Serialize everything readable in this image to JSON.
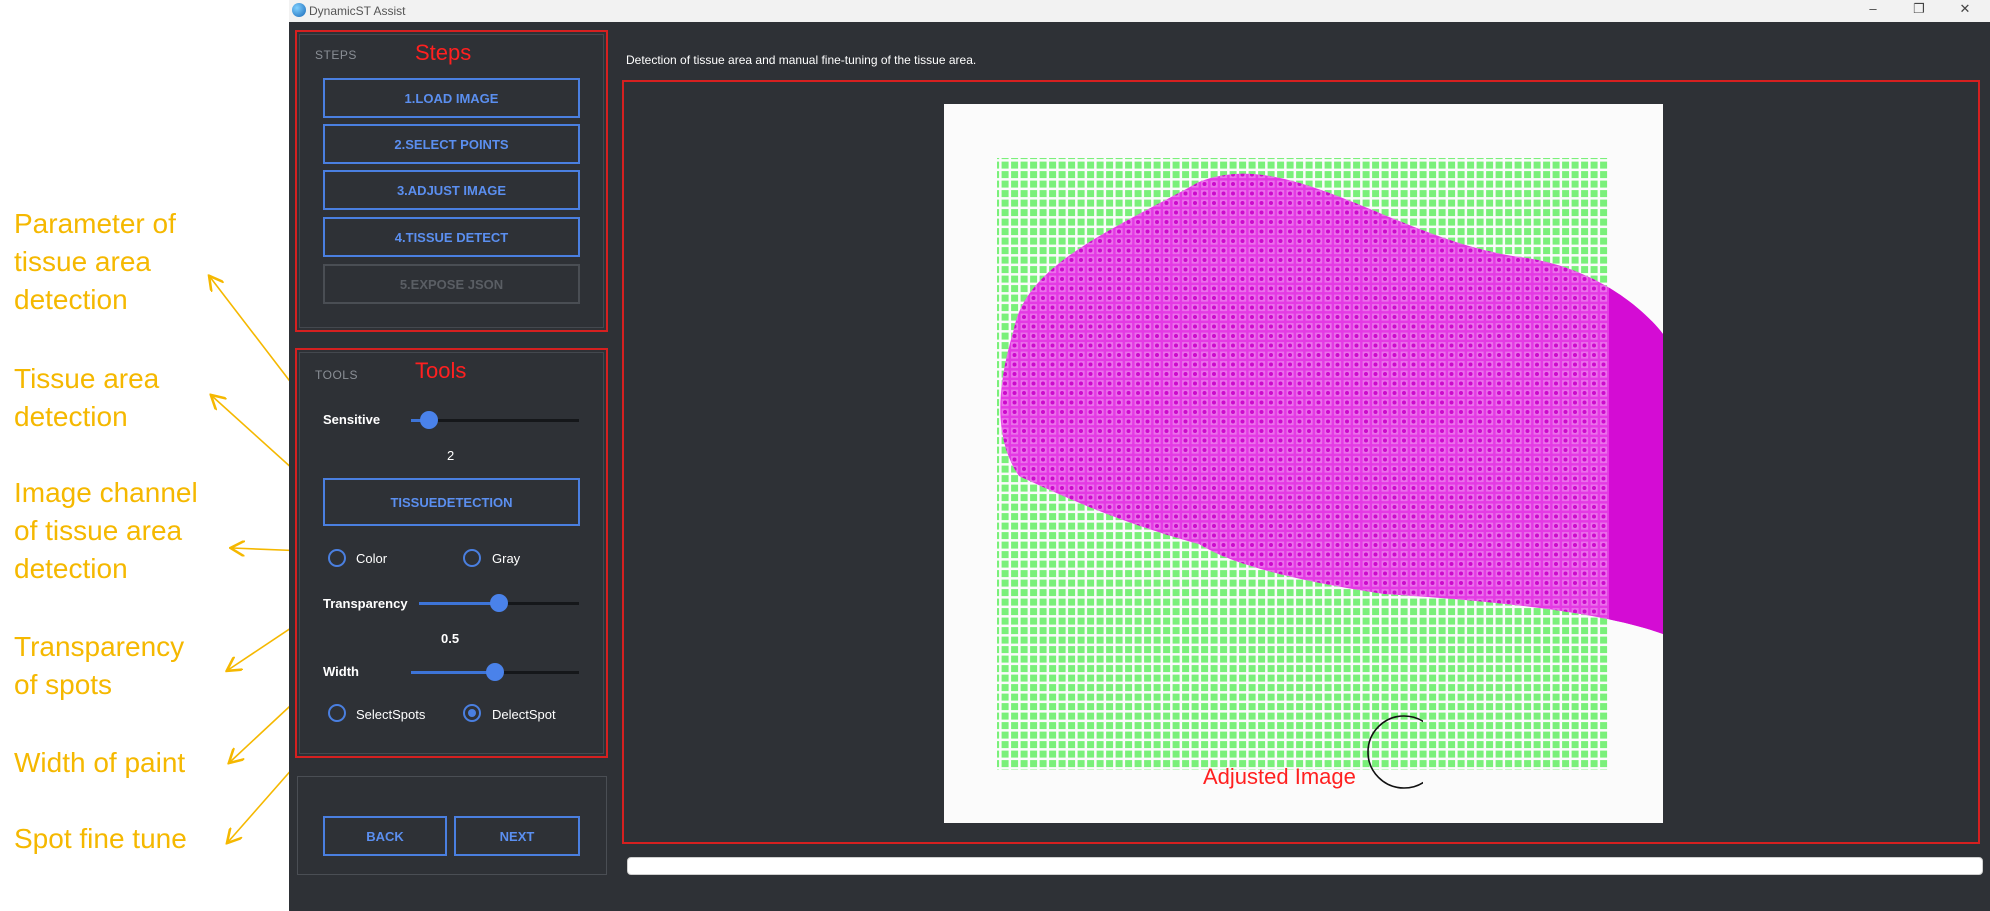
{
  "annotations": [
    "Parameter of\ntissue area\ndetection",
    " Tissue area\ndetection",
    "Image channel\nof tissue area\ndetection",
    "Transparency\nof spots",
    "Width of paint",
    "Spot fine tune"
  ],
  "window": {
    "title": "DynamicST Assist",
    "minimize": "–",
    "restore": "❐",
    "close": "✕"
  },
  "steps": {
    "section_label": "STEPS",
    "overlay_label": "Steps",
    "buttons": [
      "1.LOAD IMAGE",
      "2.SELECT POINTS",
      "3.ADJUST IMAGE",
      "4.TISSUE DETECT",
      "5.EXPOSE JSON"
    ]
  },
  "tools": {
    "section_label": "TOOLS",
    "overlay_label": "Tools",
    "sensitive_label": "Sensitive",
    "sensitive_value": "2",
    "sensitive_fraction": 0.11,
    "tissue_button": "TISSUEDETECTION",
    "channel_options": [
      {
        "label": "Color",
        "selected": false
      },
      {
        "label": "Gray",
        "selected": false
      }
    ],
    "transparency_label": "Transparency",
    "transparency_value": "0.5",
    "transparency_fraction": 0.5,
    "width_label": "Width",
    "width_fraction": 0.5,
    "spot_options": [
      {
        "label": "SelectSpots",
        "selected": false
      },
      {
        "label": "DelectSpot",
        "selected": true
      }
    ]
  },
  "nav": {
    "back": "BACK",
    "next": "NEXT"
  },
  "main": {
    "description": "Detection of tissue area and manual fine-tuning of the tissue area.",
    "image_label": "Adjusted Image",
    "progress_fraction": 0
  },
  "colors": {
    "accent": "#4a7fe0",
    "annotation": "#f5b800",
    "highlight_border": "#d62020",
    "spot_green": "#7af07a",
    "tissue_magenta": "#e020e0"
  }
}
